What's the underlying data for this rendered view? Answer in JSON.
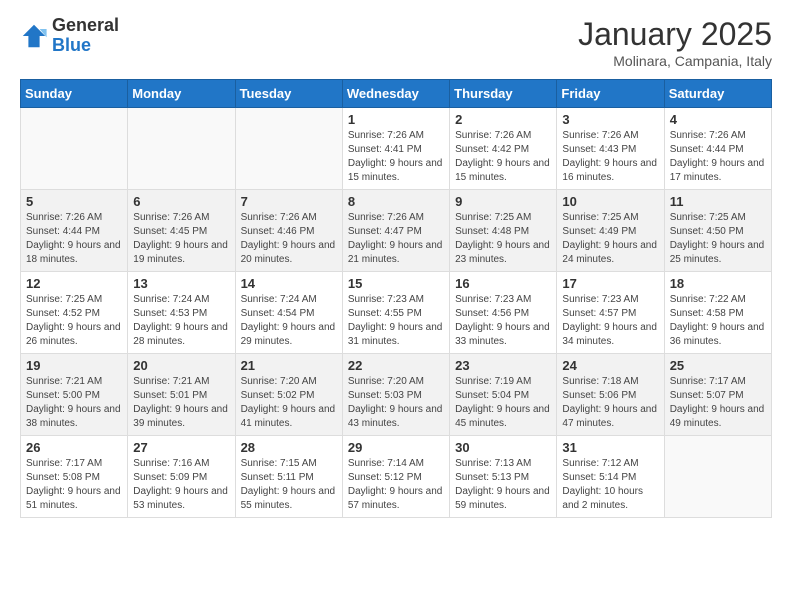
{
  "header": {
    "logo_general": "General",
    "logo_blue": "Blue",
    "month_title": "January 2025",
    "location": "Molinara, Campania, Italy"
  },
  "weekdays": [
    "Sunday",
    "Monday",
    "Tuesday",
    "Wednesday",
    "Thursday",
    "Friday",
    "Saturday"
  ],
  "weeks": [
    [
      {
        "day": "",
        "sunrise": "",
        "sunset": "",
        "daylight": ""
      },
      {
        "day": "",
        "sunrise": "",
        "sunset": "",
        "daylight": ""
      },
      {
        "day": "",
        "sunrise": "",
        "sunset": "",
        "daylight": ""
      },
      {
        "day": "1",
        "sunrise": "Sunrise: 7:26 AM",
        "sunset": "Sunset: 4:41 PM",
        "daylight": "Daylight: 9 hours and 15 minutes."
      },
      {
        "day": "2",
        "sunrise": "Sunrise: 7:26 AM",
        "sunset": "Sunset: 4:42 PM",
        "daylight": "Daylight: 9 hours and 15 minutes."
      },
      {
        "day": "3",
        "sunrise": "Sunrise: 7:26 AM",
        "sunset": "Sunset: 4:43 PM",
        "daylight": "Daylight: 9 hours and 16 minutes."
      },
      {
        "day": "4",
        "sunrise": "Sunrise: 7:26 AM",
        "sunset": "Sunset: 4:44 PM",
        "daylight": "Daylight: 9 hours and 17 minutes."
      }
    ],
    [
      {
        "day": "5",
        "sunrise": "Sunrise: 7:26 AM",
        "sunset": "Sunset: 4:44 PM",
        "daylight": "Daylight: 9 hours and 18 minutes."
      },
      {
        "day": "6",
        "sunrise": "Sunrise: 7:26 AM",
        "sunset": "Sunset: 4:45 PM",
        "daylight": "Daylight: 9 hours and 19 minutes."
      },
      {
        "day": "7",
        "sunrise": "Sunrise: 7:26 AM",
        "sunset": "Sunset: 4:46 PM",
        "daylight": "Daylight: 9 hours and 20 minutes."
      },
      {
        "day": "8",
        "sunrise": "Sunrise: 7:26 AM",
        "sunset": "Sunset: 4:47 PM",
        "daylight": "Daylight: 9 hours and 21 minutes."
      },
      {
        "day": "9",
        "sunrise": "Sunrise: 7:25 AM",
        "sunset": "Sunset: 4:48 PM",
        "daylight": "Daylight: 9 hours and 23 minutes."
      },
      {
        "day": "10",
        "sunrise": "Sunrise: 7:25 AM",
        "sunset": "Sunset: 4:49 PM",
        "daylight": "Daylight: 9 hours and 24 minutes."
      },
      {
        "day": "11",
        "sunrise": "Sunrise: 7:25 AM",
        "sunset": "Sunset: 4:50 PM",
        "daylight": "Daylight: 9 hours and 25 minutes."
      }
    ],
    [
      {
        "day": "12",
        "sunrise": "Sunrise: 7:25 AM",
        "sunset": "Sunset: 4:52 PM",
        "daylight": "Daylight: 9 hours and 26 minutes."
      },
      {
        "day": "13",
        "sunrise": "Sunrise: 7:24 AM",
        "sunset": "Sunset: 4:53 PM",
        "daylight": "Daylight: 9 hours and 28 minutes."
      },
      {
        "day": "14",
        "sunrise": "Sunrise: 7:24 AM",
        "sunset": "Sunset: 4:54 PM",
        "daylight": "Daylight: 9 hours and 29 minutes."
      },
      {
        "day": "15",
        "sunrise": "Sunrise: 7:23 AM",
        "sunset": "Sunset: 4:55 PM",
        "daylight": "Daylight: 9 hours and 31 minutes."
      },
      {
        "day": "16",
        "sunrise": "Sunrise: 7:23 AM",
        "sunset": "Sunset: 4:56 PM",
        "daylight": "Daylight: 9 hours and 33 minutes."
      },
      {
        "day": "17",
        "sunrise": "Sunrise: 7:23 AM",
        "sunset": "Sunset: 4:57 PM",
        "daylight": "Daylight: 9 hours and 34 minutes."
      },
      {
        "day": "18",
        "sunrise": "Sunrise: 7:22 AM",
        "sunset": "Sunset: 4:58 PM",
        "daylight": "Daylight: 9 hours and 36 minutes."
      }
    ],
    [
      {
        "day": "19",
        "sunrise": "Sunrise: 7:21 AM",
        "sunset": "Sunset: 5:00 PM",
        "daylight": "Daylight: 9 hours and 38 minutes."
      },
      {
        "day": "20",
        "sunrise": "Sunrise: 7:21 AM",
        "sunset": "Sunset: 5:01 PM",
        "daylight": "Daylight: 9 hours and 39 minutes."
      },
      {
        "day": "21",
        "sunrise": "Sunrise: 7:20 AM",
        "sunset": "Sunset: 5:02 PM",
        "daylight": "Daylight: 9 hours and 41 minutes."
      },
      {
        "day": "22",
        "sunrise": "Sunrise: 7:20 AM",
        "sunset": "Sunset: 5:03 PM",
        "daylight": "Daylight: 9 hours and 43 minutes."
      },
      {
        "day": "23",
        "sunrise": "Sunrise: 7:19 AM",
        "sunset": "Sunset: 5:04 PM",
        "daylight": "Daylight: 9 hours and 45 minutes."
      },
      {
        "day": "24",
        "sunrise": "Sunrise: 7:18 AM",
        "sunset": "Sunset: 5:06 PM",
        "daylight": "Daylight: 9 hours and 47 minutes."
      },
      {
        "day": "25",
        "sunrise": "Sunrise: 7:17 AM",
        "sunset": "Sunset: 5:07 PM",
        "daylight": "Daylight: 9 hours and 49 minutes."
      }
    ],
    [
      {
        "day": "26",
        "sunrise": "Sunrise: 7:17 AM",
        "sunset": "Sunset: 5:08 PM",
        "daylight": "Daylight: 9 hours and 51 minutes."
      },
      {
        "day": "27",
        "sunrise": "Sunrise: 7:16 AM",
        "sunset": "Sunset: 5:09 PM",
        "daylight": "Daylight: 9 hours and 53 minutes."
      },
      {
        "day": "28",
        "sunrise": "Sunrise: 7:15 AM",
        "sunset": "Sunset: 5:11 PM",
        "daylight": "Daylight: 9 hours and 55 minutes."
      },
      {
        "day": "29",
        "sunrise": "Sunrise: 7:14 AM",
        "sunset": "Sunset: 5:12 PM",
        "daylight": "Daylight: 9 hours and 57 minutes."
      },
      {
        "day": "30",
        "sunrise": "Sunrise: 7:13 AM",
        "sunset": "Sunset: 5:13 PM",
        "daylight": "Daylight: 9 hours and 59 minutes."
      },
      {
        "day": "31",
        "sunrise": "Sunrise: 7:12 AM",
        "sunset": "Sunset: 5:14 PM",
        "daylight": "Daylight: 10 hours and 2 minutes."
      },
      {
        "day": "",
        "sunrise": "",
        "sunset": "",
        "daylight": ""
      }
    ]
  ]
}
